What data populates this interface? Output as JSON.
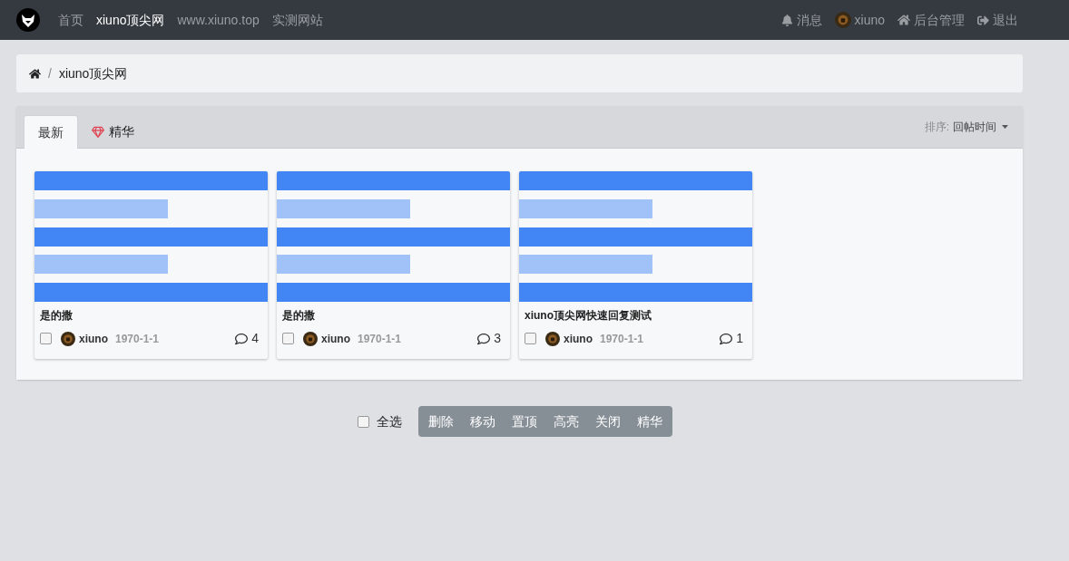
{
  "navbar": {
    "links": [
      {
        "label": "首页",
        "selected": false
      },
      {
        "label": "xiuno顶尖网",
        "selected": true
      },
      {
        "label": "www.xiuno.top",
        "selected": false
      },
      {
        "label": "实测网站",
        "selected": false
      }
    ],
    "right": [
      {
        "kind": "bell",
        "label": "消息"
      },
      {
        "kind": "avatar",
        "label": "xiuno"
      },
      {
        "kind": "home",
        "label": "后台管理"
      },
      {
        "kind": "logout",
        "label": "退出"
      }
    ]
  },
  "breadcrumb": [
    {
      "separator": "/",
      "label": "xiuno顶尖网"
    }
  ],
  "tabs": [
    {
      "label": "最新",
      "selected": true,
      "kind": "plain"
    },
    {
      "label": "精华",
      "selected": false,
      "kind": "gem"
    }
  ],
  "sort": {
    "label": "排序:",
    "value": "回帖时间"
  },
  "threads": [
    {
      "title": "是的撒",
      "author": "xiuno",
      "date": "1970-1-1",
      "replies": "4",
      "checked": false
    },
    {
      "title": "是的撒",
      "author": "xiuno",
      "date": "1970-1-1",
      "replies": "3",
      "checked": false
    },
    {
      "title": "xiuno顶尖网快速回复测试",
      "author": "xiuno",
      "date": "1970-1-1",
      "replies": "1",
      "checked": false
    }
  ],
  "select_all": {
    "label": "全选",
    "checked": false
  },
  "actions": [
    "删除",
    "移动",
    "置顶",
    "高亮",
    "关闭",
    "精华"
  ]
}
